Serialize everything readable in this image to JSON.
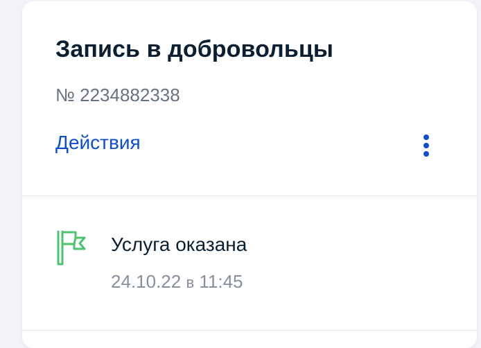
{
  "card": {
    "title": "Запись в добровольцы",
    "number": "№ 2234882338",
    "actions_label": "Действия"
  },
  "status": {
    "label": "Услуга оказана",
    "date": "24.10.22",
    "date_separator": "в",
    "time": "11:45",
    "icon": "flag-icon"
  },
  "colors": {
    "accent": "#0d4cd3",
    "success": "#4cc46d",
    "text_primary": "#0b1f33",
    "text_secondary": "#66727f",
    "background": "#f1f3f8"
  }
}
